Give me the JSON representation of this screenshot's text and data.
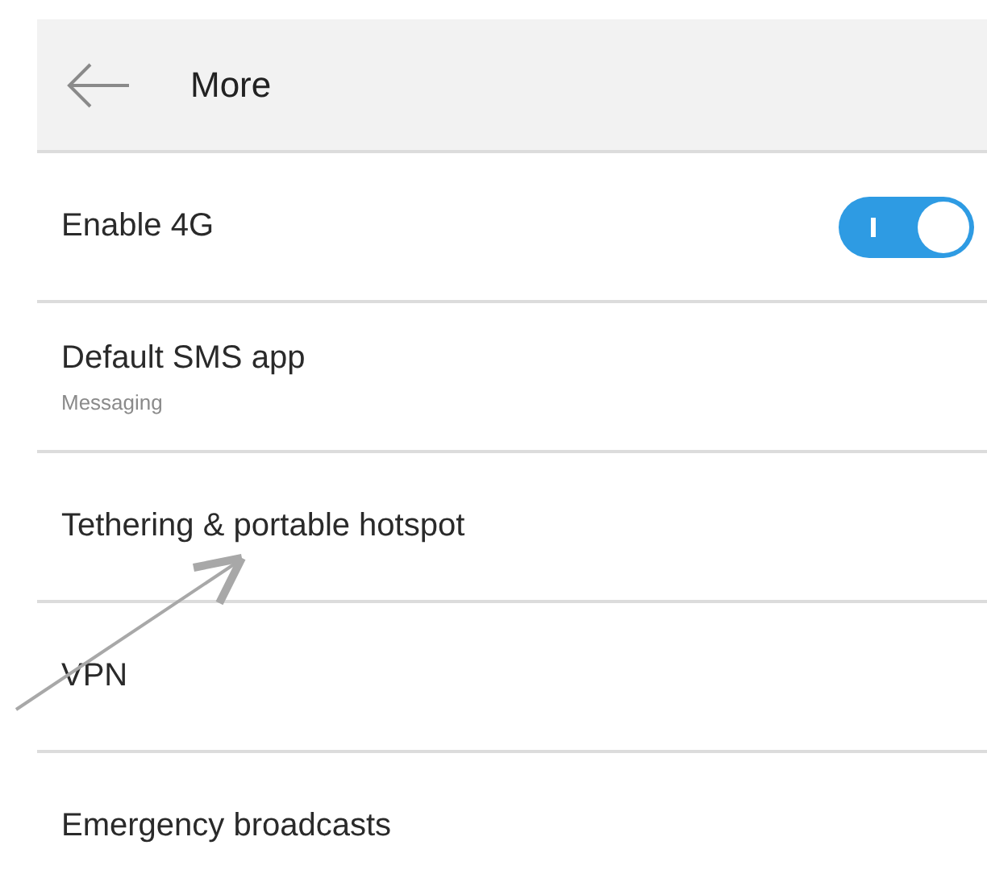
{
  "header": {
    "title": "More"
  },
  "items": [
    {
      "kind": "switch",
      "label": "Enable 4G",
      "on": true
    },
    {
      "kind": "plain",
      "label": "Default SMS app",
      "summary": "Messaging"
    },
    {
      "kind": "plain",
      "label": "Tethering & portable hotspot"
    },
    {
      "kind": "plain",
      "label": "VPN"
    },
    {
      "kind": "plain",
      "label": "Emergency broadcasts"
    }
  ]
}
